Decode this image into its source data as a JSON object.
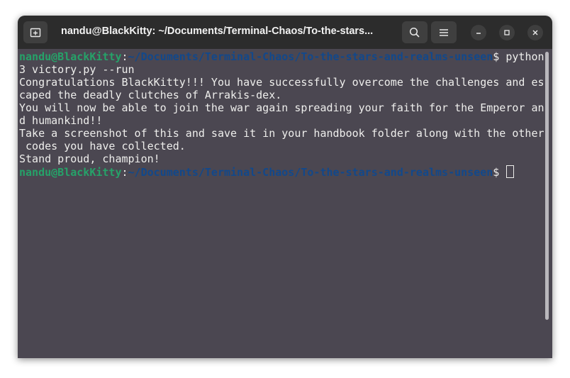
{
  "window": {
    "title": "nandu@BlackKitty: ~/Documents/Terminal-Chaos/To-the-stars..."
  },
  "titlebar": {
    "new_tab_icon": "new-tab-icon",
    "search_icon": "search-icon",
    "menu_icon": "hamburger-menu-icon",
    "minimize_icon": "minimize-icon",
    "maximize_icon": "maximize-icon",
    "close_icon": "close-icon"
  },
  "terminal": {
    "prompt_user": "nandu@BlackKitty",
    "prompt_colon": ":",
    "prompt_path": "~/Documents/Terminal-Chaos/To-the-stars-and-realms-unseen",
    "prompt_symbol": "$ ",
    "command_part1": "python",
    "command_part2": "3 victory.py --run",
    "output": [
      "Congratulations BlackKitty!!! You have successfully overcome the challenges and es",
      "caped the deadly clutches of Arrakis-dex.",
      "You will now be able to join the war again spreading your faith for the Emperor an",
      "d humankind!!",
      "Take a screenshot of this and save it in your handbook folder along with the other",
      " codes you have collected.",
      "Stand proud, champion!"
    ]
  },
  "colors": {
    "terminal_background": "#4b4751",
    "prompt_user": "#26a269",
    "prompt_path": "#12488b",
    "text": "#eeeeec",
    "titlebar": "#2c2c2c"
  }
}
